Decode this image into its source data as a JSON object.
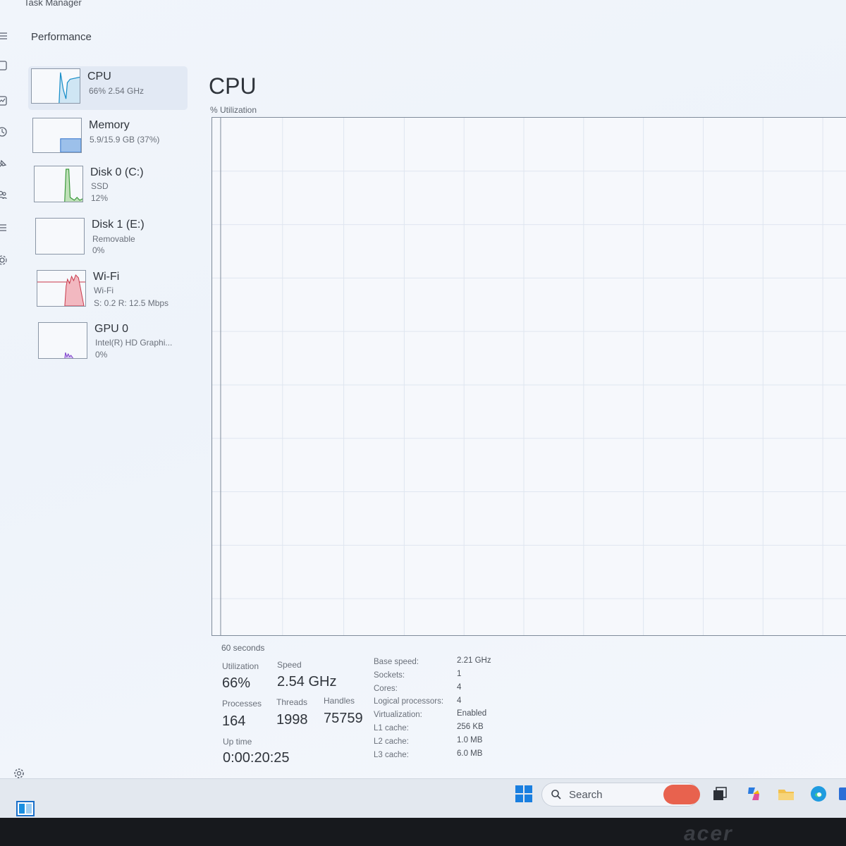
{
  "window": {
    "title": "Task Manager",
    "section_title": "Performance"
  },
  "rail": {
    "icons": [
      "hamburger-menu-icon",
      "processes-icon",
      "app-history-icon",
      "history-icon",
      "startup-icon",
      "users-icon",
      "details-icon",
      "services-icon"
    ]
  },
  "sidebar": {
    "items": [
      {
        "name": "CPU",
        "line1": "66% 2.54 GHz",
        "line2": "",
        "color": "#1a8fc9"
      },
      {
        "name": "Memory",
        "line1": "5.9/15.9 GB (37%)",
        "line2": "",
        "color": "#2a6ec9"
      },
      {
        "name": "Disk 0 (C:)",
        "line1": "SSD",
        "line2": "12%",
        "color": "#3a9a3a"
      },
      {
        "name": "Disk 1 (E:)",
        "line1": "Removable",
        "line2": "0%",
        "color": "#3a9a3a"
      },
      {
        "name": "Wi-Fi",
        "line1": "Wi-Fi",
        "line2": "S: 0.2 R: 12.5 Mbps",
        "color": "#c8384a"
      },
      {
        "name": "GPU 0",
        "line1": "Intel(R) HD Graphi...",
        "line2": "0%",
        "color": "#7a3ac9"
      }
    ]
  },
  "main": {
    "title": "CPU",
    "graph_label": "% Utilization",
    "time_label": "60 seconds",
    "stats": {
      "utilization_label": "Utilization",
      "utilization": "66%",
      "speed_label": "Speed",
      "speed": "2.54 GHz",
      "processes_label": "Processes",
      "processes": "164",
      "threads_label": "Threads",
      "threads": "1998",
      "handles_label": "Handles",
      "handles": "75759",
      "uptime_label": "Up time",
      "uptime": "0:00:20:25"
    },
    "details": [
      {
        "label": "Base speed:",
        "value": "2.21 GHz"
      },
      {
        "label": "Sockets:",
        "value": "1"
      },
      {
        "label": "Cores:",
        "value": "4"
      },
      {
        "label": "Logical processors:",
        "value": "4"
      },
      {
        "label": "Virtualization:",
        "value": "Enabled"
      },
      {
        "label": "L1 cache:",
        "value": "256 KB"
      },
      {
        "label": "L2 cache:",
        "value": "1.0 MB"
      },
      {
        "label": "L3 cache:",
        "value": "6.0 MB"
      }
    ]
  },
  "taskbar": {
    "search_placeholder": "Search",
    "apps": [
      "widgets-icon",
      "windows-start-icon",
      "task-view-icon",
      "copilot-icon",
      "file-explorer-icon",
      "edge-browser-icon"
    ]
  },
  "device": {
    "brand": "acer"
  },
  "accent_color": "#1a8fc9"
}
